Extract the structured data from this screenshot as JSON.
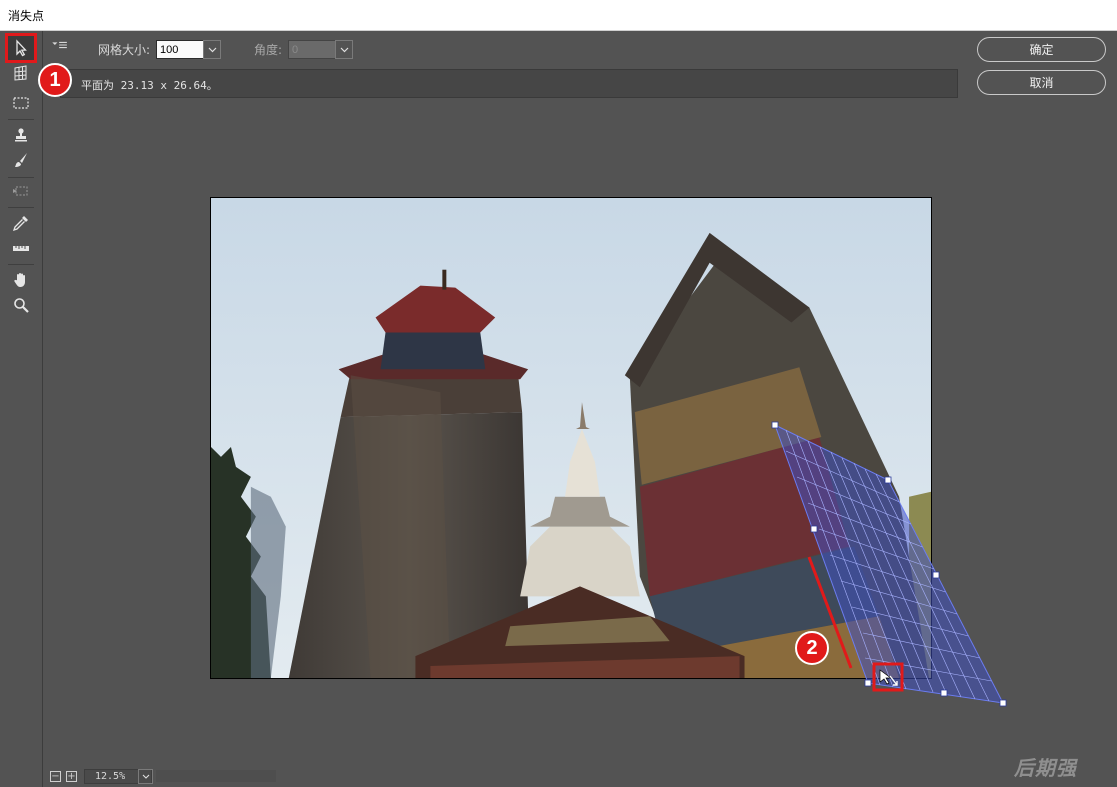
{
  "window": {
    "title": "消失点"
  },
  "toolbar": {
    "tools": [
      {
        "name": "edit-plane-tool",
        "icon": "arrow-cursor-icon",
        "active": true
      },
      {
        "name": "create-plane-tool",
        "icon": "grid-plane-icon"
      },
      {
        "name": "marquee-tool",
        "icon": "marquee-icon"
      },
      {
        "name": "stamp-tool",
        "icon": "stamp-icon"
      },
      {
        "name": "brush-tool",
        "icon": "brush-icon"
      },
      {
        "name": "transform-tool",
        "icon": "transform-icon"
      },
      {
        "name": "eyedropper-tool",
        "icon": "eyedropper-icon"
      },
      {
        "name": "measure-tool",
        "icon": "ruler-icon"
      },
      {
        "name": "hand-tool",
        "icon": "hand-icon"
      },
      {
        "name": "zoom-tool",
        "icon": "magnifier-icon"
      }
    ]
  },
  "options": {
    "grid_size_label": "网格大小:",
    "grid_size_value": "100",
    "angle_label": "角度:",
    "angle_value": "0"
  },
  "info": {
    "message": "平面为 23.13 x 26.64。"
  },
  "buttons": {
    "ok": "确定",
    "cancel": "取消"
  },
  "annotations": {
    "step1": "1",
    "step2": "2"
  },
  "status": {
    "zoom": "12.5%",
    "zoom_out": "−",
    "zoom_in": "+"
  },
  "watermark": "后期强",
  "colors": {
    "accent_red": "#e11a1a",
    "grid_blue": "#4a5cc9"
  }
}
